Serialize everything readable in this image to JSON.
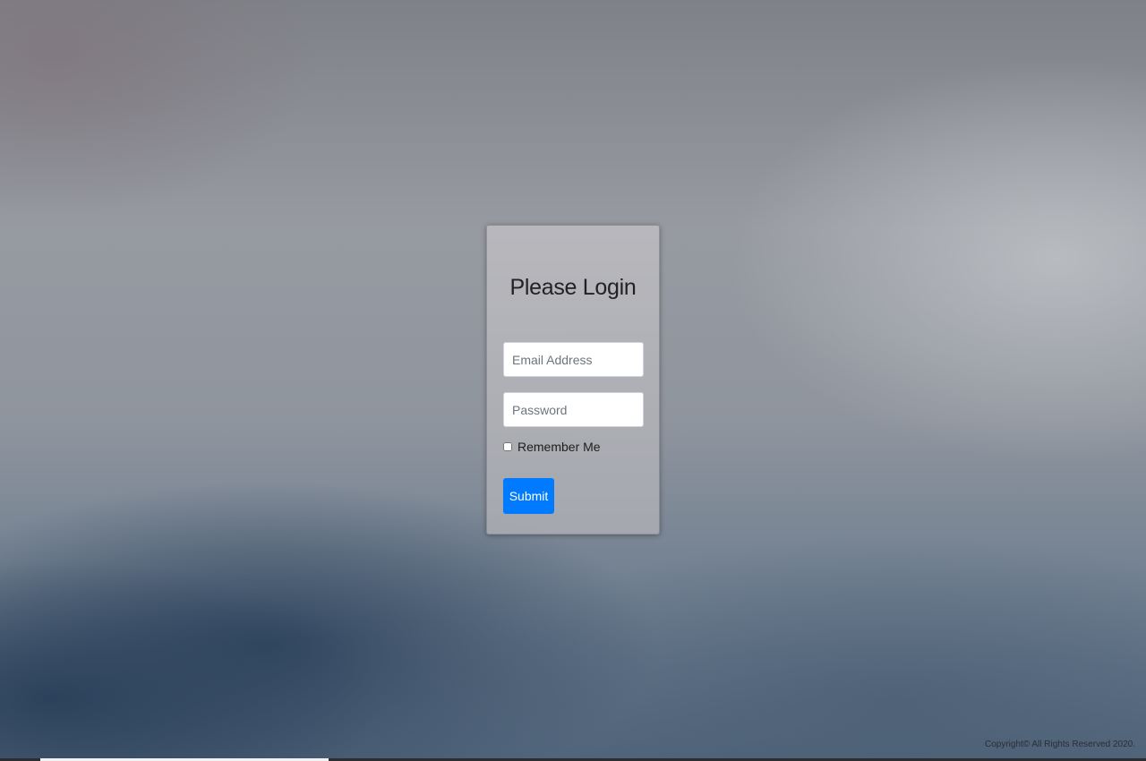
{
  "login": {
    "title": "Please Login",
    "email_placeholder": "Email Address",
    "email_value": "",
    "password_placeholder": "Password",
    "password_value": "",
    "remember_label": "Remember Me",
    "remember_checked": false,
    "submit_label": "Submit"
  },
  "footer": {
    "copyright": "Copyright© All Rights Reserved 2020."
  },
  "colors": {
    "accent": "#007bff"
  }
}
